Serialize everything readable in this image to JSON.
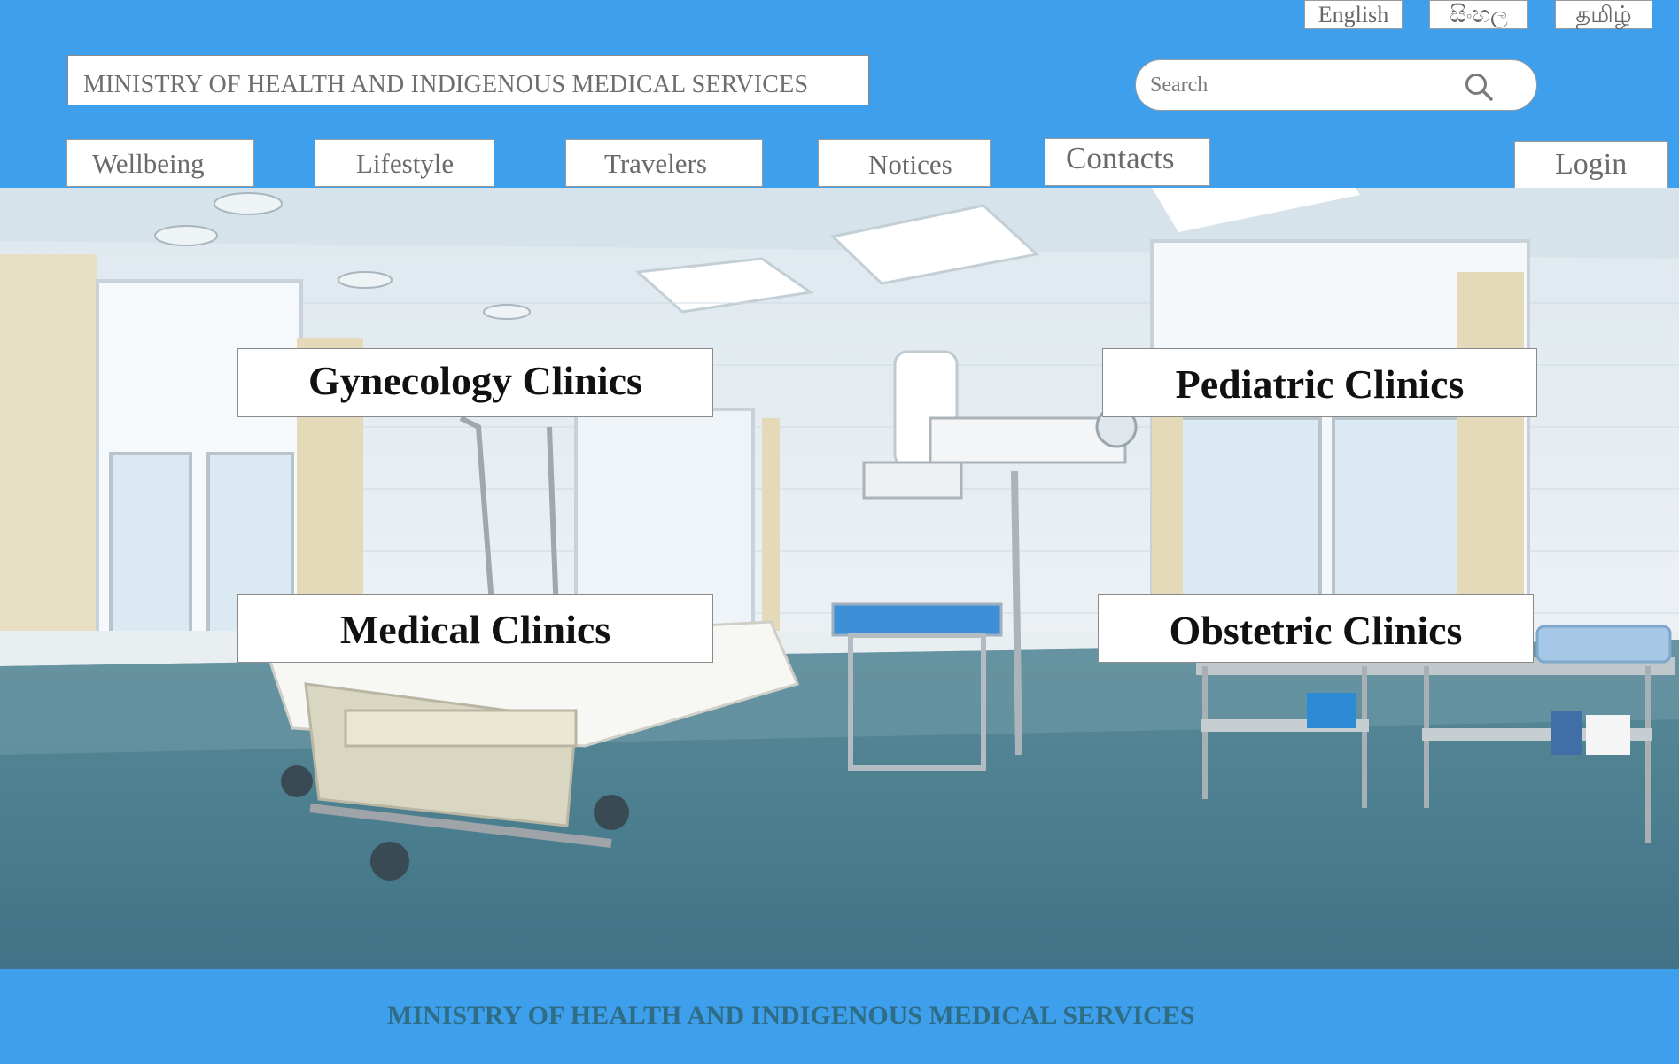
{
  "languages": {
    "english": "English",
    "sinhala": "සිංහල",
    "tamil": "தமிழ்"
  },
  "header": {
    "title": "MINISTRY OF HEALTH AND INDIGENOUS MEDICAL SERVICES"
  },
  "search": {
    "placeholder": "Search",
    "icon": "search-icon"
  },
  "nav": {
    "wellbeing": "Wellbeing",
    "lifestyle": "Lifestyle",
    "travelers": "Travelers",
    "notices": "Notices",
    "contacts": "Contacts",
    "login": "Login"
  },
  "clinics": {
    "gynecology": "Gynecology Clinics",
    "pediatric": "Pediatric Clinics",
    "medical": "Medical Clinics",
    "obstetric": "Obstetric Clinics"
  },
  "footer": {
    "text": "MINISTRY OF HEALTH AND INDIGENOUS MEDICAL SERVICES"
  },
  "colors": {
    "header_bg": "#3ea0ec",
    "footer_text": "#2f6d86"
  }
}
